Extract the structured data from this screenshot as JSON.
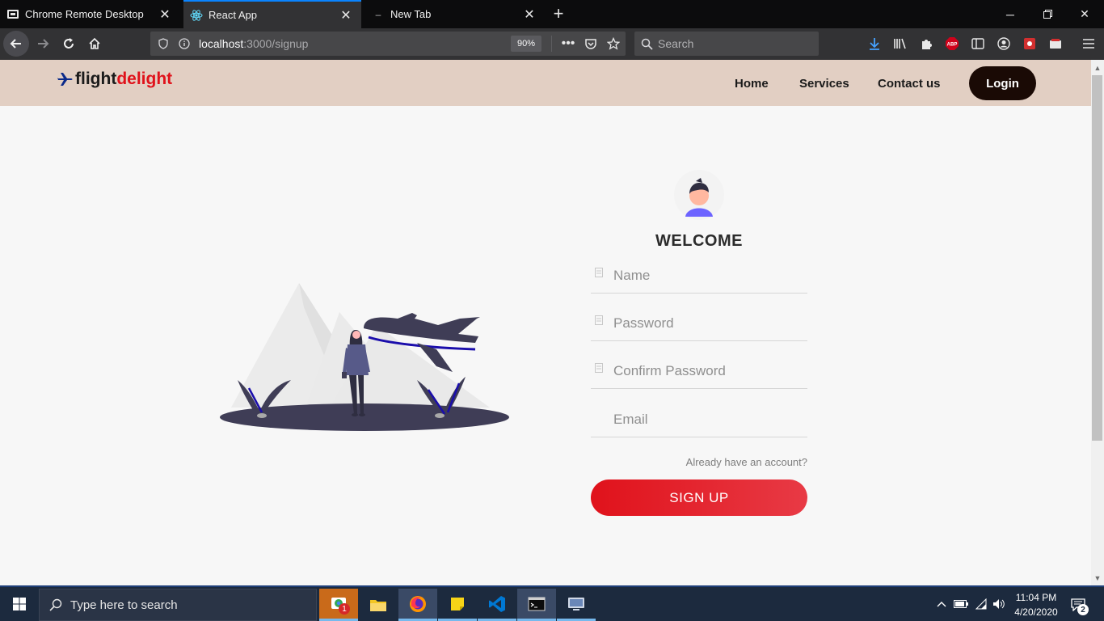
{
  "browser": {
    "tabs": [
      {
        "title": "Chrome Remote Desktop",
        "icon": "remote-desktop-icon",
        "active": false
      },
      {
        "title": "React App",
        "icon": "react-icon",
        "active": true
      },
      {
        "title": "New Tab",
        "icon": "dash-icon",
        "active": false
      }
    ],
    "url": {
      "host": "localhost",
      "path": ":3000/signup"
    },
    "zoom": "90%",
    "search_placeholder": "Search",
    "accent": "#0a84ff"
  },
  "site": {
    "logo": {
      "part1": "flight",
      "part2": "delight",
      "icon": "airplane-icon"
    },
    "nav": [
      "Home",
      "Services",
      "Contact us"
    ],
    "login_label": "Login",
    "brand_color": "#e0121b",
    "header_bg": "#e2cfc3"
  },
  "form": {
    "welcome": "WELCOME",
    "fields": [
      {
        "placeholder": "Name",
        "icon": "field-icon"
      },
      {
        "placeholder": "Password",
        "icon": "field-icon"
      },
      {
        "placeholder": "Confirm Password",
        "icon": "field-icon"
      },
      {
        "placeholder": "Email",
        "icon": ""
      }
    ],
    "already": "Already have an account?",
    "signup_label": "SIGN UP"
  },
  "taskbar": {
    "search_placeholder": "Type here to search",
    "time": "11:04 PM",
    "date": "4/20/2020",
    "notification_count": "2",
    "chrome_badge": "1"
  }
}
